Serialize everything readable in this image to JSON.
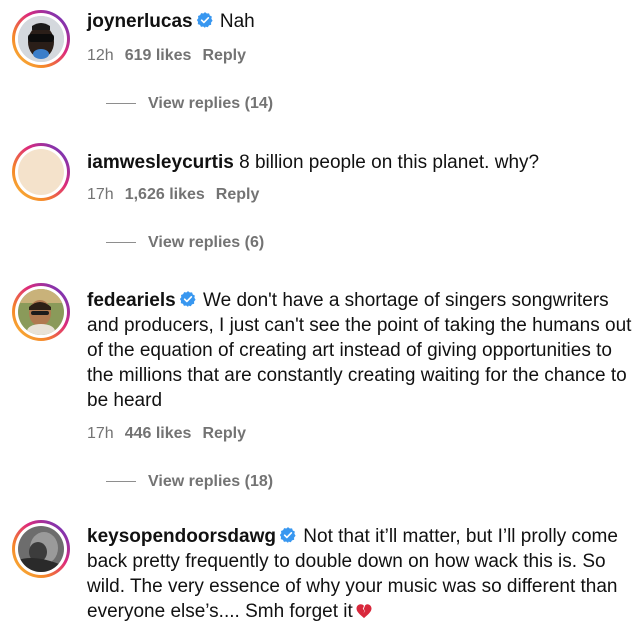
{
  "comments": [
    {
      "username": "joynerlucas",
      "verified": true,
      "text": "Nah",
      "time": "12h",
      "likes": "619 likes",
      "reply": "Reply",
      "view_replies": "View replies (14)"
    },
    {
      "username": "iamwesleycurtis",
      "verified": false,
      "text": "8 billion people on this planet. why?",
      "time": "17h",
      "likes": "1,626 likes",
      "reply": "Reply",
      "view_replies": "View replies (6)"
    },
    {
      "username": "fedeariels",
      "verified": true,
      "text": "We don't have a shortage of singers songwriters and producers, I just can't see the point of taking the humans out of the equation of creating art instead of giving opportunities to the millions that are constantly creating waiting for the chance to be heard",
      "time": "17h",
      "likes": "446 likes",
      "reply": "Reply",
      "view_replies": "View replies (18)"
    },
    {
      "username": "keysopendoorsdawg",
      "verified": true,
      "text": "Not that it’ll matter, but I’ll prolly come back pretty frequently to double down on how wack this is. So wild. The very essence of why your music was so different than everyone else’s.... Smh forget it",
      "emoji": "broken-heart-icon"
    }
  ],
  "colors": {
    "text": "#111111",
    "meta": "#737373",
    "verified": "#3897f0",
    "ring_start": "#f9c23c",
    "ring_end": "#8134af"
  }
}
